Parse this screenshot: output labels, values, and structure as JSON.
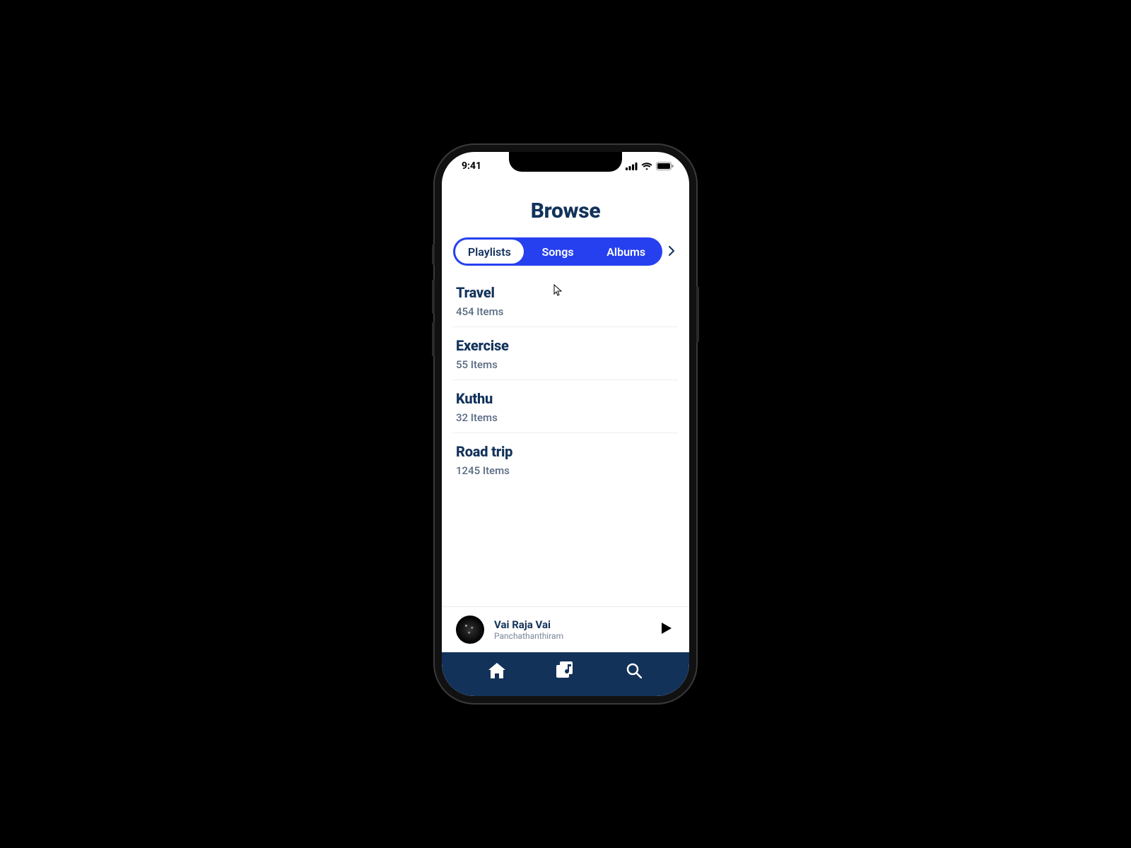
{
  "status": {
    "time": "9:41"
  },
  "header": {
    "title": "Browse"
  },
  "tabs": {
    "items": [
      {
        "label": "Playlists",
        "active": true
      },
      {
        "label": "Songs",
        "active": false
      },
      {
        "label": "Albums",
        "active": false
      }
    ]
  },
  "playlists": [
    {
      "title": "Travel",
      "subtitle": "454 Items"
    },
    {
      "title": "Exercise",
      "subtitle": "55 Items"
    },
    {
      "title": "Kuthu",
      "subtitle": "32 Items"
    },
    {
      "title": "Road trip",
      "subtitle": "1245 Items"
    }
  ],
  "now_playing": {
    "title": "Vai Raja Vai",
    "subtitle": "Panchathanthiram"
  },
  "colors": {
    "accent": "#2640ef",
    "text_primary": "#12325a",
    "nav_bg": "#12325a"
  }
}
